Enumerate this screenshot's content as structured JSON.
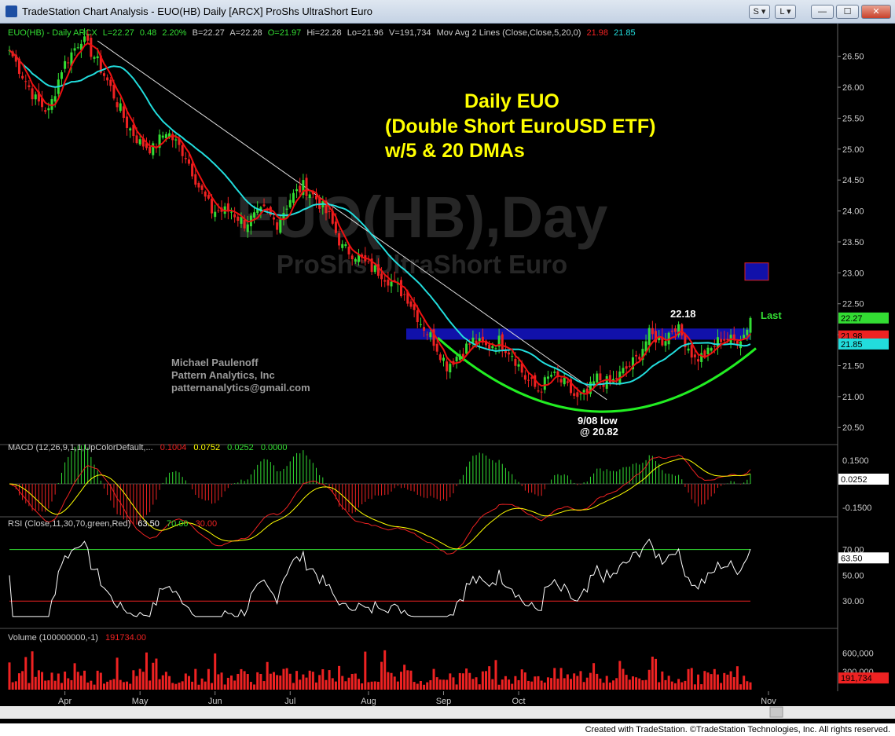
{
  "window": {
    "title": "TradeStation Chart Analysis - EUO(HB) Daily [ARCX] ProShs UltraShort Euro",
    "btn_s": "S",
    "btn_l": "L"
  },
  "footer": {
    "credit": "Created with TradeStation. ©TradeStation Technologies, Inc. All rights reserved."
  },
  "colors": {
    "background": "#000000",
    "up_candle": "#33dd33",
    "down_candle": "#ee2222",
    "ma5": "#ee1111",
    "ma20": "#22dddd",
    "annotation": "#ffff00",
    "bowl": "#22ee22",
    "band": "#1111aa"
  },
  "chart_data": [
    {
      "type": "candlestick",
      "pane": "price",
      "header": {
        "symbol": "EUO(HB) - Daily  ARCX",
        "last": "L=22.27",
        "chg": "0.48",
        "pct": "2.20%",
        "bid": "B=22.27",
        "ask": "A=22.28",
        "open": "O=21.97",
        "high": "Hi=22.28",
        "low": "Lo=21.96",
        "vol": "V=191,734",
        "ma_label": "Mov Avg 2 Lines (Close,Close,5,20,0)",
        "ma5_val": "21.98",
        "ma20_val": "21.85"
      },
      "title_lines": [
        "Daily EUO",
        "(Double Short EuroUSD ETF)",
        "w/5 & 20 DMAs"
      ],
      "watermark": [
        "EUO(HB),Day",
        "ProShs UltraShort Euro"
      ],
      "author": [
        "Michael Paulenoff",
        "Pattern Analytics, Inc",
        "patternanalytics@gmail.com"
      ],
      "annotations": {
        "high_label": "22.18",
        "last_label": "Last",
        "low_label_1": "9/08 low",
        "low_label_2": "@ 20.82"
      },
      "ylim": [
        20.3,
        26.75
      ],
      "yticks": [
        "26.50",
        "26.00",
        "25.50",
        "25.00",
        "24.50",
        "24.00",
        "23.50",
        "23.00",
        "22.50",
        "22.00",
        "21.50",
        "21.00",
        "20.50"
      ],
      "last_tags": [
        "22.27",
        "21.98",
        "21.85"
      ],
      "months": [
        "Apr",
        "May",
        "Jun",
        "Jul",
        "Aug",
        "Sep",
        "Oct",
        "Nov"
      ],
      "anchors": [
        [
          0,
          26.6
        ],
        [
          8,
          25.8
        ],
        [
          12,
          25.6
        ],
        [
          16,
          26.3
        ],
        [
          22,
          26.8
        ],
        [
          26,
          26.5
        ],
        [
          30,
          26.1
        ],
        [
          36,
          25.4
        ],
        [
          40,
          25.1
        ],
        [
          44,
          25.0
        ],
        [
          48,
          25.3
        ],
        [
          54,
          24.9
        ],
        [
          58,
          24.4
        ],
        [
          62,
          24.0
        ],
        [
          68,
          24.0
        ],
        [
          72,
          23.8
        ],
        [
          78,
          24.0
        ],
        [
          82,
          23.8
        ],
        [
          86,
          24.2
        ],
        [
          90,
          24.4
        ],
        [
          94,
          24.2
        ],
        [
          98,
          23.9
        ],
        [
          102,
          23.4
        ],
        [
          106,
          23.3
        ],
        [
          110,
          23.1
        ],
        [
          114,
          23.0
        ],
        [
          118,
          22.8
        ],
        [
          122,
          22.6
        ],
        [
          126,
          22.2
        ],
        [
          130,
          21.9
        ],
        [
          134,
          21.5
        ],
        [
          138,
          21.7
        ],
        [
          142,
          21.9
        ],
        [
          146,
          21.8
        ],
        [
          150,
          21.9
        ],
        [
          154,
          21.7
        ],
        [
          158,
          21.3
        ],
        [
          162,
          21.1
        ],
        [
          166,
          21.35
        ],
        [
          170,
          21.2
        ],
        [
          174,
          20.95
        ],
        [
          177,
          21.05
        ],
        [
          180,
          21.3
        ],
        [
          184,
          21.2
        ],
        [
          188,
          21.4
        ],
        [
          192,
          21.6
        ],
        [
          196,
          22.0
        ],
        [
          200,
          21.9
        ],
        [
          204,
          22.15
        ],
        [
          207,
          21.9
        ],
        [
          210,
          21.6
        ],
        [
          214,
          21.7
        ],
        [
          218,
          21.95
        ],
        [
          222,
          21.9
        ],
        [
          225,
          22.0
        ],
        [
          227,
          22.27
        ]
      ],
      "band": [
        21.92,
        22.1
      ],
      "bowl": [
        21.95,
        20.8
      ],
      "trendline": [
        [
          27,
          26.75
        ],
        [
          183,
          20.95
        ]
      ],
      "highlight_box": [
        22.88,
        23.16
      ]
    },
    {
      "type": "line",
      "pane": "macd",
      "label": "MACD (12,26,9,1,1,UpColorDefault,...",
      "values": [
        "0.1004",
        "0.0752",
        "0.0252",
        "0.0000"
      ],
      "yticks": [
        "0.1500",
        "-0.1500"
      ],
      "last_tag": "0.0252",
      "ylim": [
        -0.2,
        0.2
      ]
    },
    {
      "type": "line",
      "pane": "rsi",
      "label": "RSI (Close,11,30,70,green,Red)",
      "values": [
        "63.50",
        "70.00",
        "30.00"
      ],
      "yticks": [
        "70.00",
        "50.00",
        "30.00"
      ],
      "last_tag": "63.50",
      "ylim": [
        10,
        85
      ]
    },
    {
      "type": "bar",
      "pane": "volume",
      "label": "Volume (100000000,-1)",
      "value": "191734.00",
      "yticks": [
        "600,000",
        "300,000"
      ],
      "last_tag": "191,734",
      "ylim": [
        0,
        750000
      ]
    }
  ]
}
